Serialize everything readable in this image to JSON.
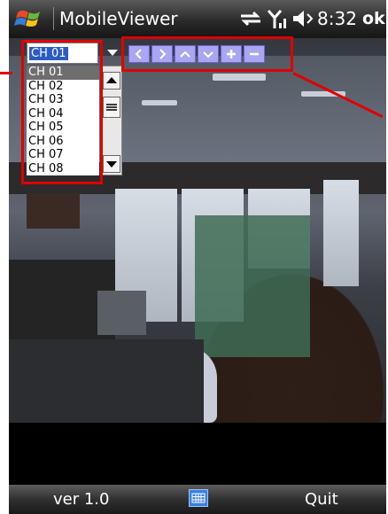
{
  "titlebar": {
    "app_title": "MobileViewer",
    "time": "8:32",
    "ok_label": "ok"
  },
  "channel_select": {
    "selected": "CH 01",
    "options": [
      "CH 01",
      "CH 02",
      "CH 03",
      "CH 04",
      "CH 05",
      "CH 06",
      "CH 07",
      "CH 08"
    ]
  },
  "ptz_controls": {
    "left": "‹",
    "right": "›",
    "up": "⌃",
    "down": "⌄",
    "zoom_in": "+",
    "zoom_out": "−"
  },
  "softkeys": {
    "left": "ver 1.0",
    "right": "Quit"
  },
  "colors": {
    "highlight": "#e00000",
    "ptz_button": "#a9a6f2",
    "selection": "#2a5cc5"
  }
}
